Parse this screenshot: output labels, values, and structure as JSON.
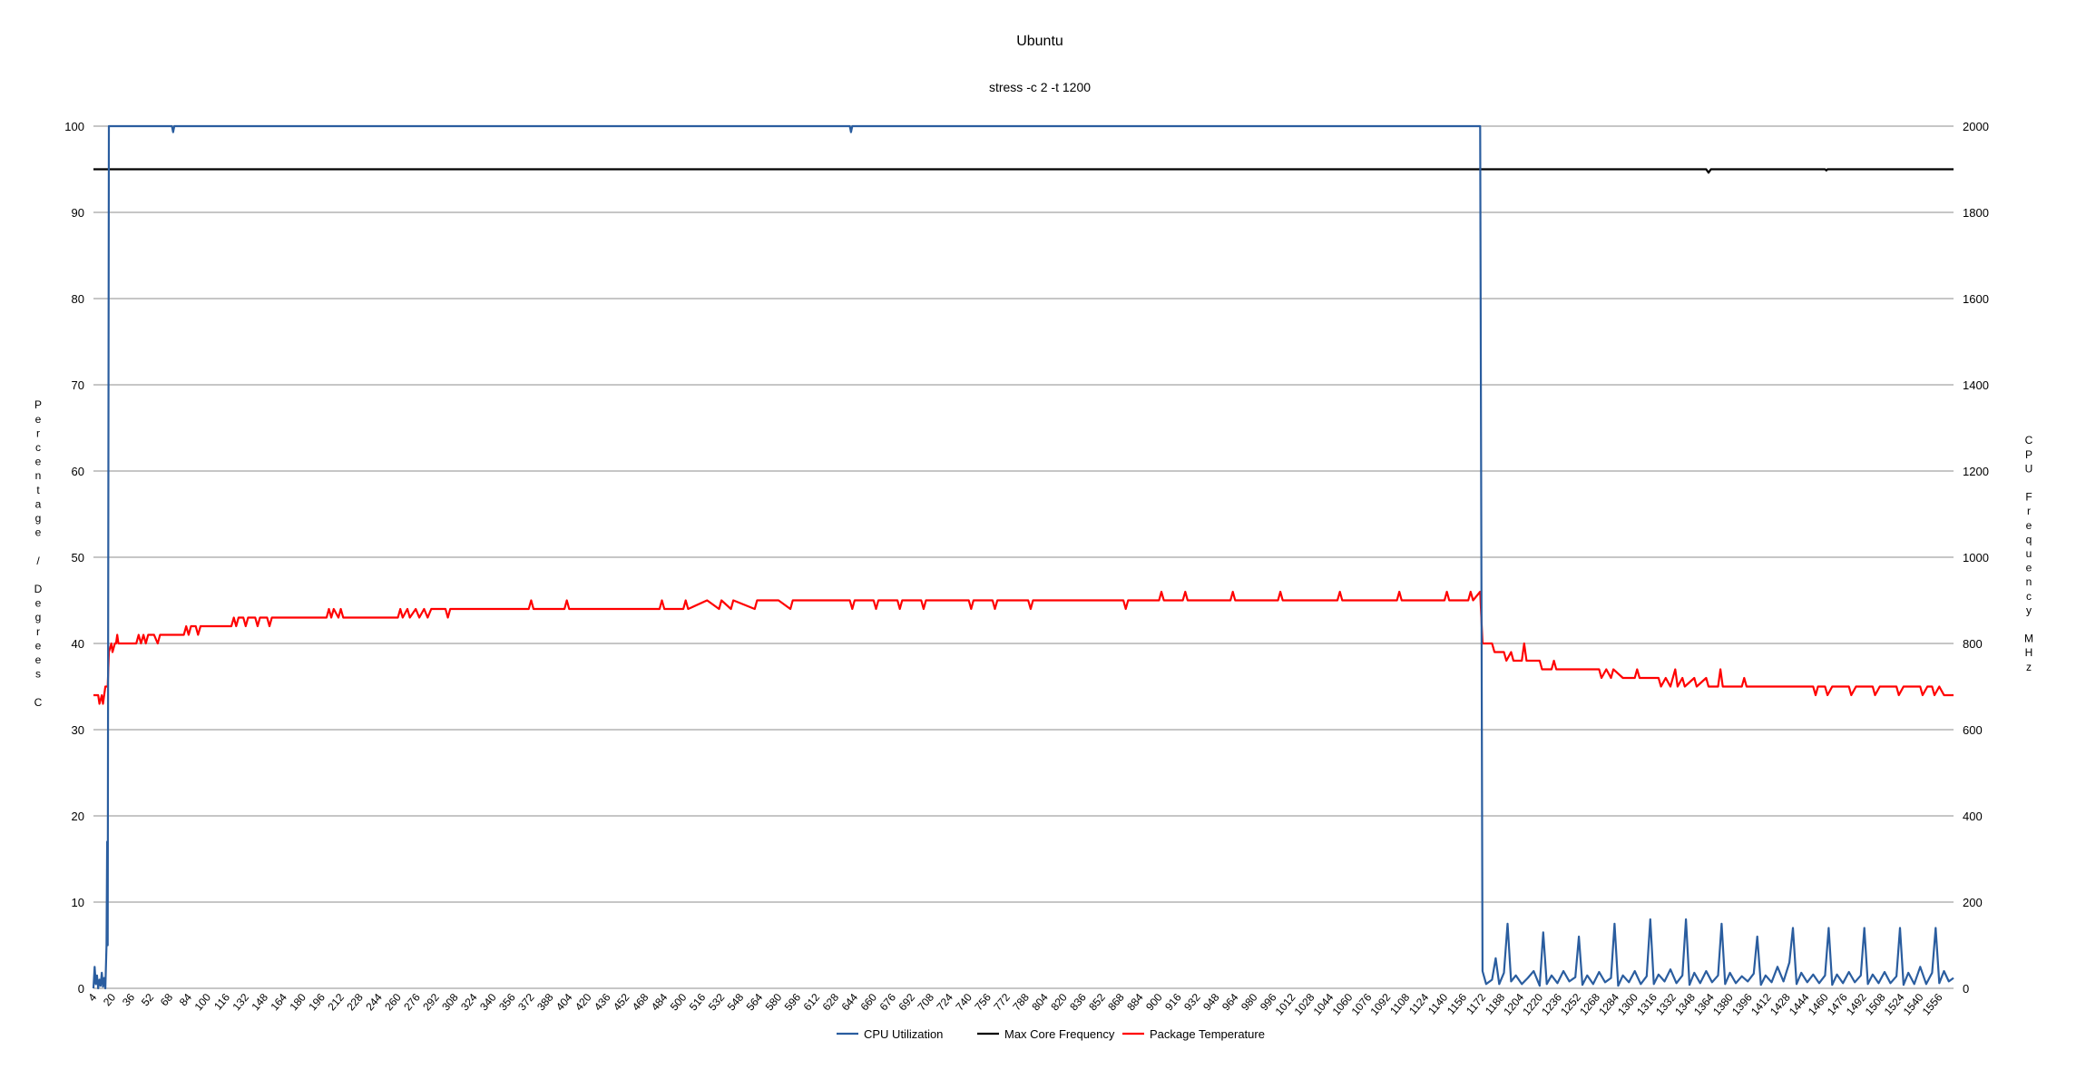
{
  "chart_data": {
    "type": "line",
    "title": "Ubuntu",
    "subtitle": "stress -c 2 -t 1200",
    "ylabel_left": "Percentage / Degrees C",
    "ylabel_right": "CPU Frequency MHz",
    "xlabel": "",
    "ylim_left": [
      0,
      100
    ],
    "ylim_right": [
      0,
      2000
    ],
    "yticks_left": [
      0,
      10,
      20,
      30,
      40,
      50,
      60,
      70,
      80,
      90,
      100
    ],
    "yticks_right": [
      0,
      200,
      400,
      600,
      800,
      1000,
      1200,
      1400,
      1600,
      1800,
      2000
    ],
    "xlim": [
      4,
      1568
    ],
    "xtick_start": 4,
    "xtick_step": 16,
    "xtick_count": 98,
    "grid": true,
    "legend_position": "bottom",
    "series": [
      {
        "name": "CPU Utilization",
        "color": "#2a5d9f",
        "axis": "left",
        "points": [
          [
            4,
            0
          ],
          [
            5,
            2.5
          ],
          [
            6,
            0.5
          ],
          [
            7,
            1.5
          ],
          [
            8,
            0
          ],
          [
            9,
            1
          ],
          [
            10,
            0.3
          ],
          [
            11,
            1.8
          ],
          [
            12,
            0.2
          ],
          [
            13,
            1.2
          ],
          [
            14,
            0
          ],
          [
            15,
            5
          ],
          [
            15.5,
            17
          ],
          [
            16,
            5
          ],
          [
            17,
            100
          ],
          [
            70,
            100
          ],
          [
            71,
            99.3
          ],
          [
            72,
            100
          ],
          [
            640,
            100
          ],
          [
            641,
            99.3
          ],
          [
            642,
            100
          ],
          [
            1170,
            100
          ],
          [
            1172,
            2
          ],
          [
            1175,
            0.5
          ],
          [
            1180,
            1
          ],
          [
            1183,
            3.5
          ],
          [
            1186,
            0.5
          ],
          [
            1190,
            1.8
          ],
          [
            1193,
            7.5
          ],
          [
            1196,
            0.8
          ],
          [
            1200,
            1.5
          ],
          [
            1205,
            0.5
          ],
          [
            1210,
            1.2
          ],
          [
            1215,
            2
          ],
          [
            1220,
            0.3
          ],
          [
            1223,
            6.5
          ],
          [
            1226,
            0.5
          ],
          [
            1230,
            1.5
          ],
          [
            1235,
            0.6
          ],
          [
            1240,
            2
          ],
          [
            1245,
            0.8
          ],
          [
            1250,
            1.3
          ],
          [
            1253,
            6
          ],
          [
            1256,
            0.4
          ],
          [
            1260,
            1.5
          ],
          [
            1265,
            0.5
          ],
          [
            1270,
            1.9
          ],
          [
            1275,
            0.7
          ],
          [
            1280,
            1.2
          ],
          [
            1283,
            7.5
          ],
          [
            1286,
            0.3
          ],
          [
            1290,
            1.5
          ],
          [
            1295,
            0.7
          ],
          [
            1300,
            2
          ],
          [
            1305,
            0.5
          ],
          [
            1310,
            1.4
          ],
          [
            1313,
            8
          ],
          [
            1316,
            0.5
          ],
          [
            1320,
            1.6
          ],
          [
            1325,
            0.8
          ],
          [
            1330,
            2.2
          ],
          [
            1335,
            0.6
          ],
          [
            1340,
            1.5
          ],
          [
            1343,
            8
          ],
          [
            1346,
            0.4
          ],
          [
            1350,
            1.8
          ],
          [
            1355,
            0.6
          ],
          [
            1360,
            2
          ],
          [
            1365,
            0.7
          ],
          [
            1370,
            1.5
          ],
          [
            1373,
            7.5
          ],
          [
            1376,
            0.5
          ],
          [
            1380,
            1.8
          ],
          [
            1385,
            0.6
          ],
          [
            1390,
            1.4
          ],
          [
            1395,
            0.8
          ],
          [
            1400,
            1.7
          ],
          [
            1403,
            6
          ],
          [
            1406,
            0.4
          ],
          [
            1410,
            1.5
          ],
          [
            1415,
            0.7
          ],
          [
            1420,
            2.5
          ],
          [
            1425,
            0.8
          ],
          [
            1430,
            3
          ],
          [
            1433,
            7
          ],
          [
            1436,
            0.5
          ],
          [
            1440,
            1.8
          ],
          [
            1445,
            0.7
          ],
          [
            1450,
            1.6
          ],
          [
            1455,
            0.6
          ],
          [
            1460,
            1.5
          ],
          [
            1463,
            7
          ],
          [
            1466,
            0.4
          ],
          [
            1470,
            1.6
          ],
          [
            1475,
            0.6
          ],
          [
            1480,
            1.9
          ],
          [
            1485,
            0.7
          ],
          [
            1490,
            1.5
          ],
          [
            1493,
            7
          ],
          [
            1496,
            0.5
          ],
          [
            1500,
            1.6
          ],
          [
            1505,
            0.6
          ],
          [
            1510,
            1.9
          ],
          [
            1515,
            0.6
          ],
          [
            1520,
            1.4
          ],
          [
            1523,
            7
          ],
          [
            1526,
            0.4
          ],
          [
            1530,
            1.8
          ],
          [
            1535,
            0.5
          ],
          [
            1540,
            2.5
          ],
          [
            1545,
            0.5
          ],
          [
            1550,
            1.8
          ],
          [
            1553,
            7
          ],
          [
            1556,
            0.6
          ],
          [
            1560,
            2
          ],
          [
            1564,
            0.8
          ],
          [
            1568,
            1.2
          ]
        ]
      },
      {
        "name": "Max Core Frequency",
        "color": "#000000",
        "axis": "right",
        "points": [
          [
            4,
            1900
          ],
          [
            1360,
            1900
          ],
          [
            1362,
            1892
          ],
          [
            1364,
            1900
          ],
          [
            1460,
            1900
          ],
          [
            1461,
            1897
          ],
          [
            1462,
            1900
          ],
          [
            1568,
            1900
          ]
        ]
      },
      {
        "name": "Package Temperature",
        "color": "#ff0000",
        "axis": "left",
        "points": [
          [
            4,
            34
          ],
          [
            8,
            34
          ],
          [
            9,
            33
          ],
          [
            11,
            34
          ],
          [
            12,
            33
          ],
          [
            14,
            35
          ],
          [
            16,
            35
          ],
          [
            17,
            39
          ],
          [
            19,
            40
          ],
          [
            20,
            39
          ],
          [
            22,
            40
          ],
          [
            23,
            40
          ],
          [
            24,
            41
          ],
          [
            25,
            40
          ],
          [
            40,
            40
          ],
          [
            42,
            41
          ],
          [
            44,
            40
          ],
          [
            46,
            41
          ],
          [
            48,
            40
          ],
          [
            50,
            41
          ],
          [
            55,
            41
          ],
          [
            58,
            40
          ],
          [
            60,
            41
          ],
          [
            80,
            41
          ],
          [
            82,
            42
          ],
          [
            84,
            41
          ],
          [
            86,
            42
          ],
          [
            90,
            42
          ],
          [
            92,
            41
          ],
          [
            94,
            42
          ],
          [
            120,
            42
          ],
          [
            122,
            43
          ],
          [
            124,
            42
          ],
          [
            126,
            43
          ],
          [
            130,
            43
          ],
          [
            132,
            42
          ],
          [
            134,
            43
          ],
          [
            140,
            43
          ],
          [
            142,
            42
          ],
          [
            144,
            43
          ],
          [
            150,
            43
          ],
          [
            152,
            42
          ],
          [
            154,
            43
          ],
          [
            200,
            43
          ],
          [
            202,
            44
          ],
          [
            204,
            43
          ],
          [
            206,
            44
          ],
          [
            210,
            43
          ],
          [
            212,
            44
          ],
          [
            214,
            43
          ],
          [
            260,
            43
          ],
          [
            262,
            44
          ],
          [
            264,
            43
          ],
          [
            268,
            44
          ],
          [
            270,
            43
          ],
          [
            275,
            44
          ],
          [
            278,
            43
          ],
          [
            282,
            44
          ],
          [
            285,
            43
          ],
          [
            288,
            44
          ],
          [
            300,
            44
          ],
          [
            302,
            43
          ],
          [
            304,
            44
          ],
          [
            370,
            44
          ],
          [
            372,
            45
          ],
          [
            374,
            44
          ],
          [
            400,
            44
          ],
          [
            402,
            45
          ],
          [
            404,
            44
          ],
          [
            480,
            44
          ],
          [
            482,
            45
          ],
          [
            484,
            44
          ],
          [
            500,
            44
          ],
          [
            502,
            45
          ],
          [
            504,
            44
          ],
          [
            520,
            45
          ],
          [
            530,
            44
          ],
          [
            532,
            45
          ],
          [
            540,
            44
          ],
          [
            542,
            45
          ],
          [
            560,
            44
          ],
          [
            562,
            45
          ],
          [
            580,
            45
          ],
          [
            590,
            44
          ],
          [
            592,
            45
          ],
          [
            640,
            45
          ],
          [
            642,
            44
          ],
          [
            644,
            45
          ],
          [
            660,
            45
          ],
          [
            662,
            44
          ],
          [
            664,
            45
          ],
          [
            680,
            45
          ],
          [
            682,
            44
          ],
          [
            684,
            45
          ],
          [
            700,
            45
          ],
          [
            702,
            44
          ],
          [
            704,
            45
          ],
          [
            740,
            45
          ],
          [
            742,
            44
          ],
          [
            744,
            45
          ],
          [
            760,
            45
          ],
          [
            762,
            44
          ],
          [
            764,
            45
          ],
          [
            790,
            45
          ],
          [
            792,
            44
          ],
          [
            794,
            45
          ],
          [
            870,
            45
          ],
          [
            872,
            44
          ],
          [
            874,
            45
          ],
          [
            900,
            45
          ],
          [
            902,
            46
          ],
          [
            904,
            45
          ],
          [
            920,
            45
          ],
          [
            922,
            46
          ],
          [
            924,
            45
          ],
          [
            960,
            45
          ],
          [
            962,
            46
          ],
          [
            964,
            45
          ],
          [
            1000,
            45
          ],
          [
            1002,
            46
          ],
          [
            1004,
            45
          ],
          [
            1050,
            45
          ],
          [
            1052,
            46
          ],
          [
            1054,
            45
          ],
          [
            1100,
            45
          ],
          [
            1102,
            46
          ],
          [
            1104,
            45
          ],
          [
            1140,
            45
          ],
          [
            1142,
            46
          ],
          [
            1144,
            45
          ],
          [
            1160,
            45
          ],
          [
            1162,
            46
          ],
          [
            1164,
            45
          ],
          [
            1170,
            46
          ],
          [
            1172,
            40
          ],
          [
            1180,
            40
          ],
          [
            1182,
            39
          ],
          [
            1190,
            39
          ],
          [
            1192,
            38
          ],
          [
            1196,
            39
          ],
          [
            1198,
            38
          ],
          [
            1205,
            38
          ],
          [
            1207,
            40
          ],
          [
            1209,
            38
          ],
          [
            1220,
            38
          ],
          [
            1222,
            37
          ],
          [
            1230,
            37
          ],
          [
            1232,
            38
          ],
          [
            1234,
            37
          ],
          [
            1270,
            37
          ],
          [
            1272,
            36
          ],
          [
            1276,
            37
          ],
          [
            1280,
            36
          ],
          [
            1282,
            37
          ],
          [
            1290,
            36
          ],
          [
            1300,
            36
          ],
          [
            1302,
            37
          ],
          [
            1304,
            36
          ],
          [
            1320,
            36
          ],
          [
            1322,
            35
          ],
          [
            1326,
            36
          ],
          [
            1330,
            35
          ],
          [
            1334,
            37
          ],
          [
            1336,
            35
          ],
          [
            1340,
            36
          ],
          [
            1342,
            35
          ],
          [
            1350,
            36
          ],
          [
            1352,
            35
          ],
          [
            1360,
            36
          ],
          [
            1362,
            35
          ],
          [
            1370,
            35
          ],
          [
            1372,
            37
          ],
          [
            1374,
            35
          ],
          [
            1390,
            35
          ],
          [
            1392,
            36
          ],
          [
            1394,
            35
          ],
          [
            1450,
            35
          ],
          [
            1452,
            34
          ],
          [
            1454,
            35
          ],
          [
            1460,
            35
          ],
          [
            1462,
            34
          ],
          [
            1466,
            35
          ],
          [
            1480,
            35
          ],
          [
            1482,
            34
          ],
          [
            1486,
            35
          ],
          [
            1500,
            35
          ],
          [
            1502,
            34
          ],
          [
            1506,
            35
          ],
          [
            1520,
            35
          ],
          [
            1522,
            34
          ],
          [
            1526,
            35
          ],
          [
            1540,
            35
          ],
          [
            1542,
            34
          ],
          [
            1546,
            35
          ],
          [
            1550,
            35
          ],
          [
            1552,
            34
          ],
          [
            1556,
            35
          ],
          [
            1560,
            34
          ],
          [
            1568,
            34
          ]
        ]
      }
    ]
  }
}
